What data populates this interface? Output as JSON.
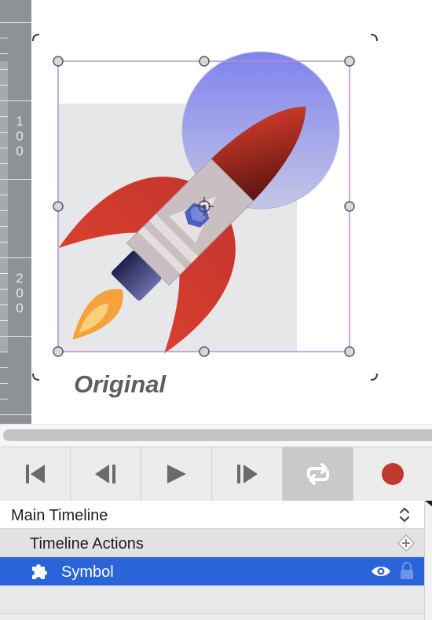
{
  "ruler": {
    "labels": [
      "1\n0\n0",
      "2\n0\n0"
    ]
  },
  "canvas": {
    "caption": "Original"
  },
  "toolbar": {
    "buttons": [
      {
        "icon": "skip-to-start-icon"
      },
      {
        "icon": "step-backward-icon"
      },
      {
        "icon": "play-icon"
      },
      {
        "icon": "step-forward-icon"
      },
      {
        "icon": "loop-icon",
        "active": true
      },
      {
        "icon": "record-icon"
      }
    ]
  },
  "timeline": {
    "selector_label": "Main Timeline",
    "rows": [
      {
        "label": "Timeline Actions",
        "icon": "add-action-icon"
      },
      {
        "label": "Symbol",
        "icon": "puzzle-piece-icon",
        "selected": true,
        "visible_icon": "eye-icon",
        "lock_icon": "lock-icon"
      }
    ]
  },
  "colors": {
    "selection": "#2b63d9",
    "record": "#c0392f",
    "selection_frame": "#b98fd6",
    "circle_top": "#7f83ee",
    "rocket_red": "#cf3c2e"
  }
}
